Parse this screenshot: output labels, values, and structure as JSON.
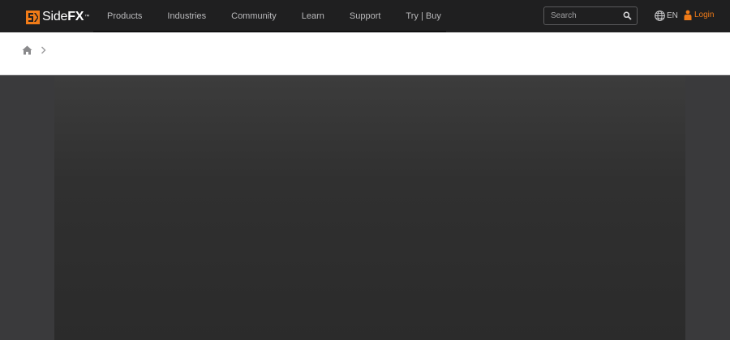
{
  "brand": {
    "name_light": "Side",
    "name_bold": "FX",
    "trademark": "™",
    "accent_color": "#f07b18"
  },
  "nav": {
    "items": [
      {
        "label": "Products"
      },
      {
        "label": "Industries"
      },
      {
        "label": "Community"
      },
      {
        "label": "Learn"
      },
      {
        "label": "Support"
      },
      {
        "label": "Try | Buy"
      }
    ]
  },
  "search": {
    "placeholder": "Search",
    "icon": "search-icon"
  },
  "language": {
    "label": "EN",
    "icon": "globe-icon"
  },
  "login": {
    "label": "Login",
    "icon": "user-icon"
  },
  "breadcrumb": {
    "home_icon": "home-icon",
    "separator_icon": "chevron-right-icon"
  }
}
